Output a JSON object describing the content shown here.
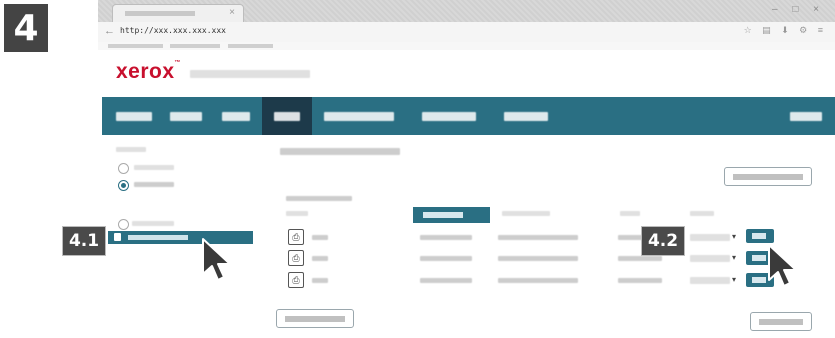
{
  "step": {
    "number": "4",
    "callouts": [
      "4.1",
      "4.2"
    ]
  },
  "browser": {
    "url": "http://xxx.xxx.xxx.xxx",
    "tab_icon": "close-icon",
    "back_icon": "arrow-left-icon"
  },
  "page": {
    "logo": "xerox",
    "logo_tm": "™",
    "brand_color": "#c8102e",
    "nav_color": "#2a6f83",
    "nav_active_color": "#1d3a4a"
  },
  "icons": {
    "printer": "printer-icon",
    "cursor": "mouse-pointer-icon",
    "caret": "chevron-down-icon"
  }
}
